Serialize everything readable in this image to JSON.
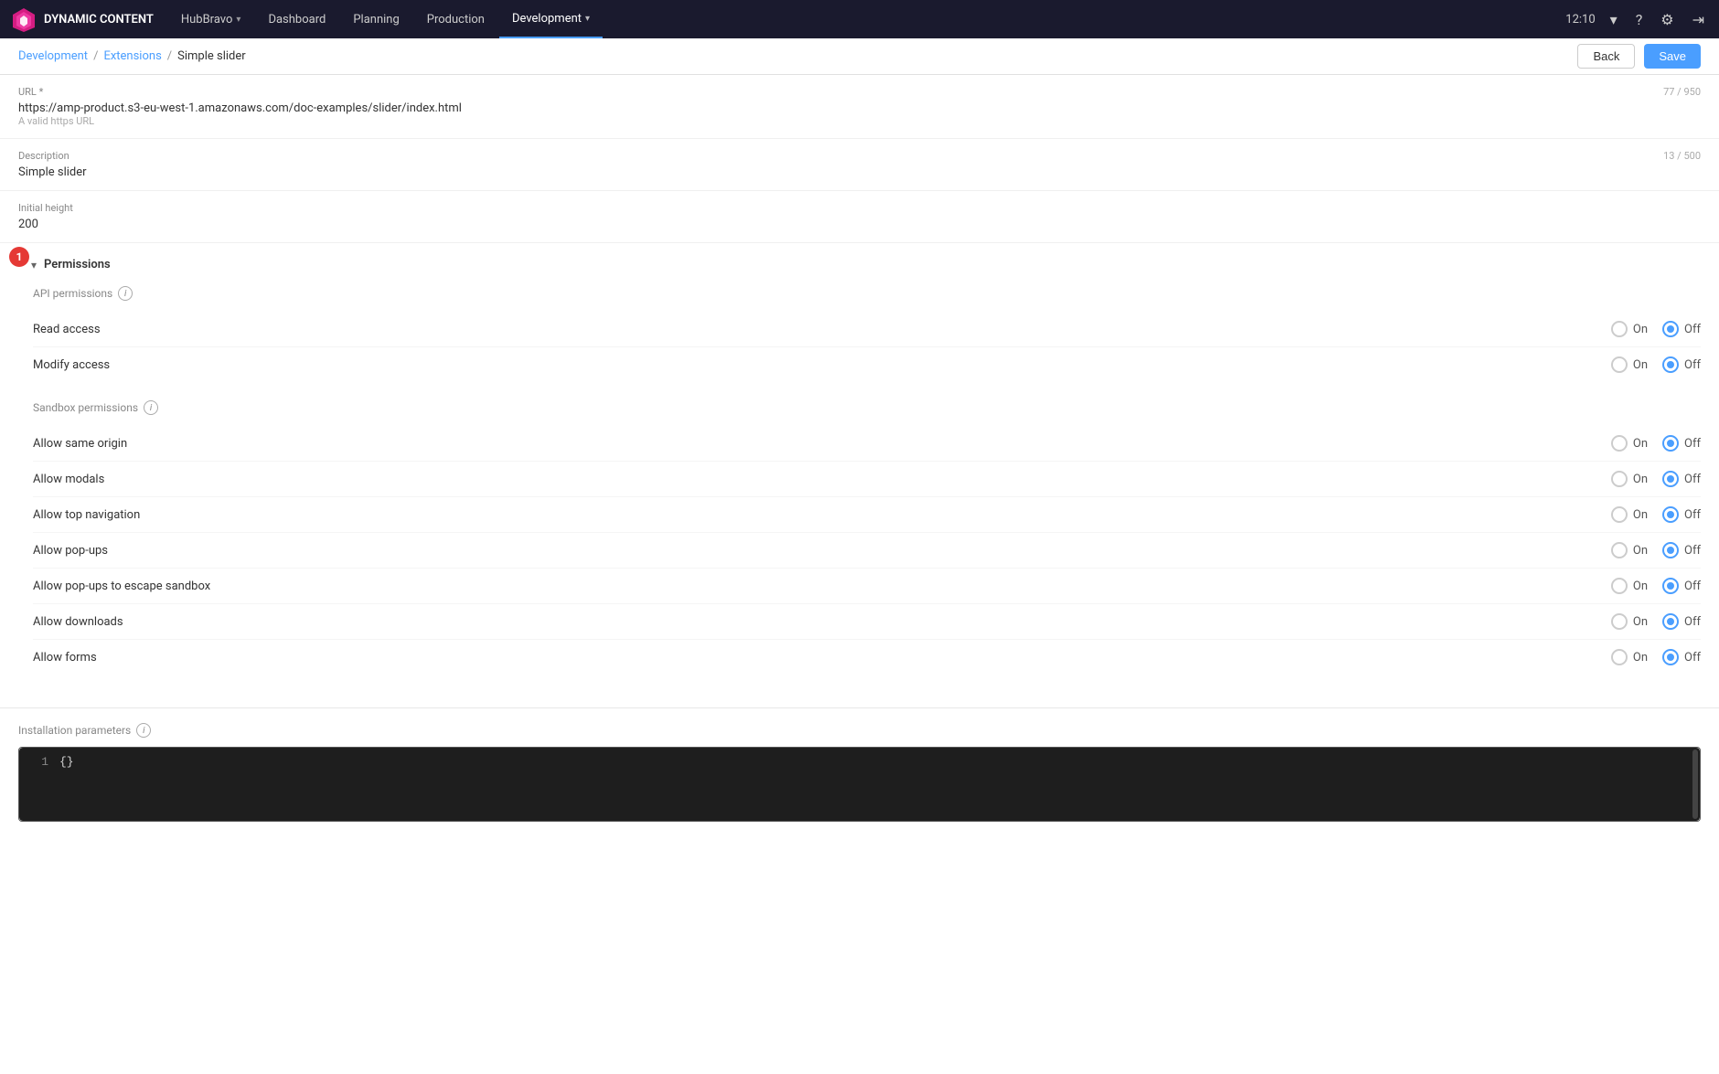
{
  "nav": {
    "brand": "DYNAMIC CONTENT",
    "items": [
      {
        "label": "HubBravo",
        "active": false,
        "hasDropdown": true
      },
      {
        "label": "Dashboard",
        "active": false,
        "hasDropdown": false
      },
      {
        "label": "Planning",
        "active": false,
        "hasDropdown": false
      },
      {
        "label": "Production",
        "active": false,
        "hasDropdown": false
      },
      {
        "label": "Development",
        "active": true,
        "hasDropdown": true
      }
    ],
    "time": "12:10"
  },
  "breadcrumb": {
    "items": [
      {
        "label": "Development",
        "link": true
      },
      {
        "label": "Extensions",
        "link": true
      },
      {
        "label": "Simple slider",
        "link": false
      }
    ],
    "back_label": "Back",
    "save_label": "Save"
  },
  "form": {
    "url_label": "URL *",
    "url_value": "https://amp-product.s3-eu-west-1.amazonaws.com/doc-examples/slider/index.html",
    "url_hint": "A valid https URL",
    "url_char_count": "77 / 950",
    "description_label": "Description",
    "description_value": "Simple slider",
    "description_char_count": "13 / 500",
    "initial_height_label": "Initial height",
    "initial_height_value": "200"
  },
  "permissions": {
    "section_label": "Permissions",
    "step_number": "1",
    "api_permissions_label": "API permissions",
    "api_items": [
      {
        "label": "Read access",
        "on_selected": false,
        "off_selected": true
      },
      {
        "label": "Modify access",
        "on_selected": false,
        "off_selected": true
      }
    ],
    "sandbox_permissions_label": "Sandbox permissions",
    "sandbox_items": [
      {
        "label": "Allow same origin",
        "on_selected": false,
        "off_selected": true
      },
      {
        "label": "Allow modals",
        "on_selected": false,
        "off_selected": true
      },
      {
        "label": "Allow top navigation",
        "on_selected": false,
        "off_selected": true
      },
      {
        "label": "Allow pop-ups",
        "on_selected": false,
        "off_selected": true
      },
      {
        "label": "Allow pop-ups to escape sandbox",
        "on_selected": false,
        "off_selected": true
      },
      {
        "label": "Allow downloads",
        "on_selected": false,
        "off_selected": true
      },
      {
        "label": "Allow forms",
        "on_selected": false,
        "off_selected": true
      }
    ],
    "on_label": "On",
    "off_label": "Off"
  },
  "installation_params": {
    "section_label": "Installation parameters",
    "line_number": "1",
    "code_content": "{}"
  }
}
